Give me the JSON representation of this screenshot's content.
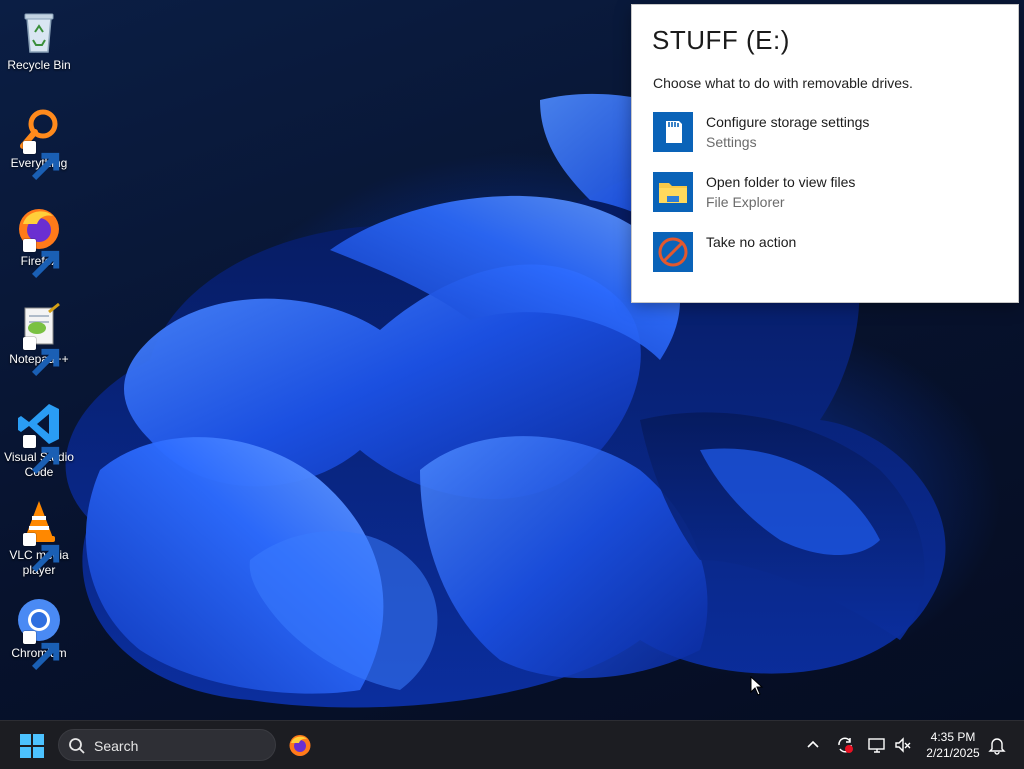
{
  "desktop": {
    "icons": [
      {
        "label": "Recycle Bin",
        "icon": "recycle-bin-icon"
      },
      {
        "label": "Everything",
        "icon": "everything-search-icon"
      },
      {
        "label": "Firefox",
        "icon": "firefox-icon"
      },
      {
        "label": "Notepad++",
        "icon": "notepad-plus-plus-icon"
      },
      {
        "label": "Visual Studio Code",
        "icon": "vscode-icon"
      },
      {
        "label": "VLC media player",
        "icon": "vlc-icon"
      },
      {
        "label": "Chromium",
        "icon": "chromium-icon"
      }
    ]
  },
  "autoplay": {
    "title": "STUFF (E:)",
    "subtitle": "Choose what to do with removable drives.",
    "options": [
      {
        "title": "Configure storage settings",
        "sub": "Settings",
        "icon": "sd-card-icon"
      },
      {
        "title": "Open folder to view files",
        "sub": "File Explorer",
        "icon": "folder-icon"
      },
      {
        "title": "Take no action",
        "sub": "",
        "icon": "no-action-icon"
      }
    ],
    "accent": "#0a63b8"
  },
  "taskbar": {
    "search_label": "Search",
    "clock_time": "4:35 PM",
    "clock_date": "2/21/2025",
    "tray_icons": [
      "chevron-up-icon",
      "sync-alert-icon",
      "display-icon",
      "volume-muted-icon",
      "notification-bell-icon"
    ]
  }
}
